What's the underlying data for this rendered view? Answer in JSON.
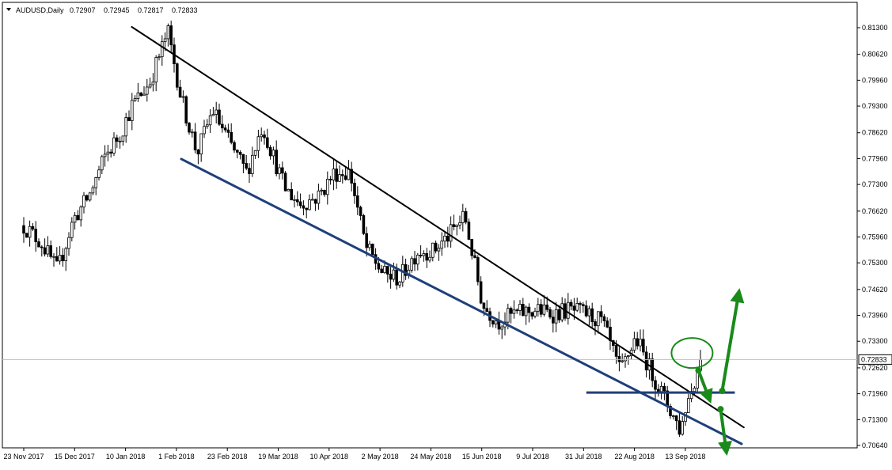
{
  "header": {
    "symbol": "AUDUSD,Daily",
    "open": "0.72907",
    "high": "0.72945",
    "low": "0.72817",
    "close": "0.72833"
  },
  "colors": {
    "background": "#ffffff",
    "bull_candle": "#ffffff",
    "bear_candle": "#000000",
    "wick": "#000000",
    "resistance_line": "#000000",
    "support_line": "#1f3f7a",
    "level_line": "#1f3f7a",
    "arrows": "#1a8a1a",
    "price_line": "#c0c0c0",
    "price_label_bg": "#ffffff"
  },
  "chart_data": {
    "type": "candlestick",
    "symbol": "AUDUSD",
    "timeframe": "Daily",
    "ylim": [
      0.7064,
      0.8161
    ],
    "y_ticks": [
      "0.81300",
      "0.80620",
      "0.79960",
      "0.79300",
      "0.78620",
      "0.77960",
      "0.77300",
      "0.76620",
      "0.75960",
      "0.75300",
      "0.74620",
      "0.73960",
      "0.73300",
      "0.72620",
      "0.71960",
      "0.71300",
      "0.70640"
    ],
    "x_ticks": [
      "23 Nov 2017",
      "15 Dec 2017",
      "10 Jan 2018",
      "1 Feb 2018",
      "23 Feb 2018",
      "19 Mar 2018",
      "10 Apr 2018",
      "2 May 2018",
      "24 May 2018",
      "15 Jun 2018",
      "9 Jul 2018",
      "31 Jul 2018",
      "22 Aug 2018",
      "13 Sep 2018"
    ],
    "current_price": "0.72833",
    "path": [
      [
        "23 Nov 2017",
        0.7625
      ],
      [
        "1 Dec 2017",
        0.758
      ],
      [
        "8 Dec 2017",
        0.751
      ],
      [
        "15 Dec 2017",
        0.764
      ],
      [
        "22 Dec 2017",
        0.77
      ],
      [
        "29 Dec 2017",
        0.78
      ],
      [
        "5 Jan 2018",
        0.786
      ],
      [
        "10 Jan 2018",
        0.793
      ],
      [
        "18 Jan 2018",
        0.799
      ],
      [
        "26 Jan 2018",
        0.812
      ],
      [
        "1 Feb 2018",
        0.795
      ],
      [
        "8 Feb 2018",
        0.781
      ],
      [
        "15 Feb 2018",
        0.792
      ],
      [
        "23 Feb 2018",
        0.783
      ],
      [
        "2 Mar 2018",
        0.776
      ],
      [
        "9 Mar 2018",
        0.788
      ],
      [
        "19 Mar 2018",
        0.772
      ],
      [
        "26 Mar 2018",
        0.768
      ],
      [
        "3 Apr 2018",
        0.77
      ],
      [
        "10 Apr 2018",
        0.776
      ],
      [
        "17 Apr 2018",
        0.776
      ],
      [
        "24 Apr 2018",
        0.757
      ],
      [
        "2 May 2018",
        0.75
      ],
      [
        "9 May 2018",
        0.749
      ],
      [
        "17 May 2018",
        0.756
      ],
      [
        "24 May 2018",
        0.756
      ],
      [
        "31 May 2018",
        0.76
      ],
      [
        "7 Jun 2018",
        0.765
      ],
      [
        "15 Jun 2018",
        0.742
      ],
      [
        "22 Jun 2018",
        0.738
      ],
      [
        "29 Jun 2018",
        0.74
      ],
      [
        "9 Jul 2018",
        0.741
      ],
      [
        "16 Jul 2018",
        0.74
      ],
      [
        "23 Jul 2018",
        0.741
      ],
      [
        "31 Jul 2018",
        0.74
      ],
      [
        "7 Aug 2018",
        0.738
      ],
      [
        "15 Aug 2018",
        0.725
      ],
      [
        "22 Aug 2018",
        0.734
      ],
      [
        "29 Aug 2018",
        0.725
      ],
      [
        "5 Sep 2018",
        0.717
      ],
      [
        "11 Sep 2018",
        0.71
      ],
      [
        "13 Sep 2018",
        0.716
      ],
      [
        "20 Sep 2018",
        0.7283
      ]
    ],
    "annotations": {
      "resistance_line": [
        [
          "10 Jan 2018",
          0.8132
        ],
        [
          "9 Oct 2018",
          0.711
        ]
      ],
      "support_line": [
        [
          "1 Feb 2018",
          0.7795
        ],
        [
          "8 Oct 2018",
          0.7068
        ]
      ],
      "level_line": {
        "y": 0.7199,
        "x_from": "31 Jul 2018",
        "x_to": "5 Oct 2018"
      },
      "circle_at": [
        "16 Sep 2018",
        0.73
      ],
      "arrows": [
        "down-from-circle",
        "up-breakout",
        "down-breakdown"
      ]
    }
  }
}
